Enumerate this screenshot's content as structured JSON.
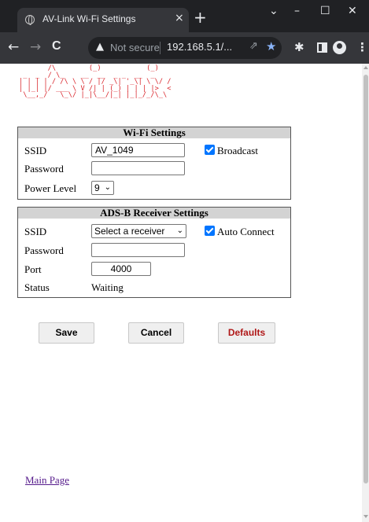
{
  "browser": {
    "tab_title": "AV-Link Wi-Fi Settings",
    "tab_close": "×",
    "new_tab": "+",
    "window_controls": {
      "dropdown": "⌄",
      "minimize": "–",
      "maximize": "☐",
      "close": "✕"
    },
    "nav": {
      "back": "←",
      "forward": "→",
      "reload": "C"
    },
    "address": {
      "warning_icon": "▲",
      "not_secure": "Not secure",
      "url": "192.168.5.1/...",
      "share_icon": "⇗",
      "star_icon": "★"
    },
    "toolbar_icons": {
      "extensions": "✱",
      "menu": "⋮"
    }
  },
  "logo": {
    "ascii": "       /\\        (_)           (_)\n _  _  / \\_    __  __  _ _  __  _\n| | | | / /\\ \\ \\ / |/ _\\| '_\\| \\ \\/ /\n| |_| |/ ___ \\ V /| | (_) | | | |>  <\n \\__,_/   \\_\\/ |_|\\__/|_| |_|_/_/\\_\\"
  },
  "wifi": {
    "heading": "Wi-Fi Settings",
    "ssid_label": "SSID",
    "ssid_value": "AV_1049",
    "broadcast_label": "Broadcast",
    "broadcast_checked": true,
    "password_label": "Password",
    "password_value": "",
    "power_label": "Power Level",
    "power_value": "9",
    "chevron": "⌄"
  },
  "adsb": {
    "heading": "ADS-B Receiver Settings",
    "ssid_label": "SSID",
    "receiver_select": "Select a receiver",
    "auto_connect_label": "Auto Connect",
    "auto_connect_checked": true,
    "password_label": "Password",
    "password_value": "",
    "port_label": "Port",
    "port_value": "4000",
    "status_label": "Status",
    "status_value": "Waiting"
  },
  "buttons": {
    "save": "Save",
    "cancel": "Cancel",
    "defaults": "Defaults"
  },
  "links": {
    "main_page": "Main Page"
  },
  "colors": {
    "accent_blue": "#0075ff",
    "logo_red": "#d9242a",
    "defaults_red": "#b01818",
    "visited_link": "#551a8b"
  }
}
